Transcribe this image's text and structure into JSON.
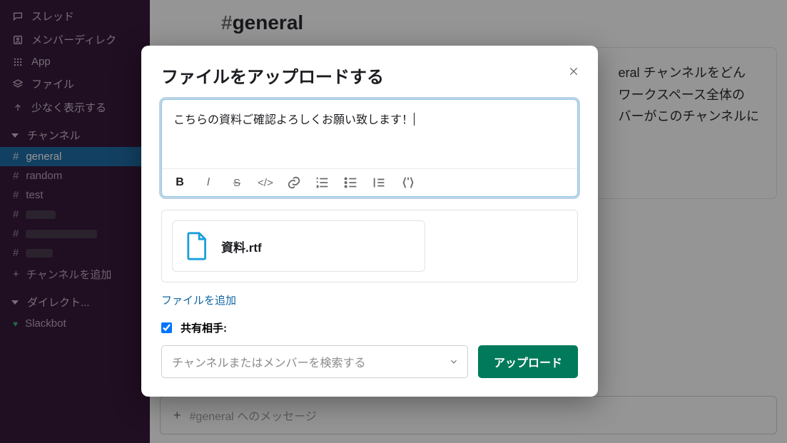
{
  "sidebar": {
    "items": [
      {
        "label": "スレッド"
      },
      {
        "label": "メンバーディレク"
      },
      {
        "label": "App"
      },
      {
        "label": "ファイル"
      },
      {
        "label": "少なく表示する"
      }
    ],
    "channels_header": "チャンネル",
    "channels": [
      {
        "label": "general",
        "active": true
      },
      {
        "label": "random"
      },
      {
        "label": "test"
      }
    ],
    "add_channel": "チャンネルを追加",
    "dm_header": "ダイレクト...",
    "dms": [
      {
        "label": "Slackbot"
      }
    ]
  },
  "main": {
    "channel_name": "general",
    "description": "チャンネルをどん　ワークスペース全体の　ーがこのチャンネルに",
    "msg_placeholder": "#general へのメッセージ"
  },
  "modal": {
    "title": "ファイルをアップロードする",
    "message": "こちらの資料ご確認よろしくお願い致します！",
    "file_name": "資料.rtf",
    "add_file": "ファイルを追加",
    "share_label": "共有相手:",
    "share_placeholder": "チャンネルまたはメンバーを検索する",
    "upload_label": "アップロード"
  }
}
